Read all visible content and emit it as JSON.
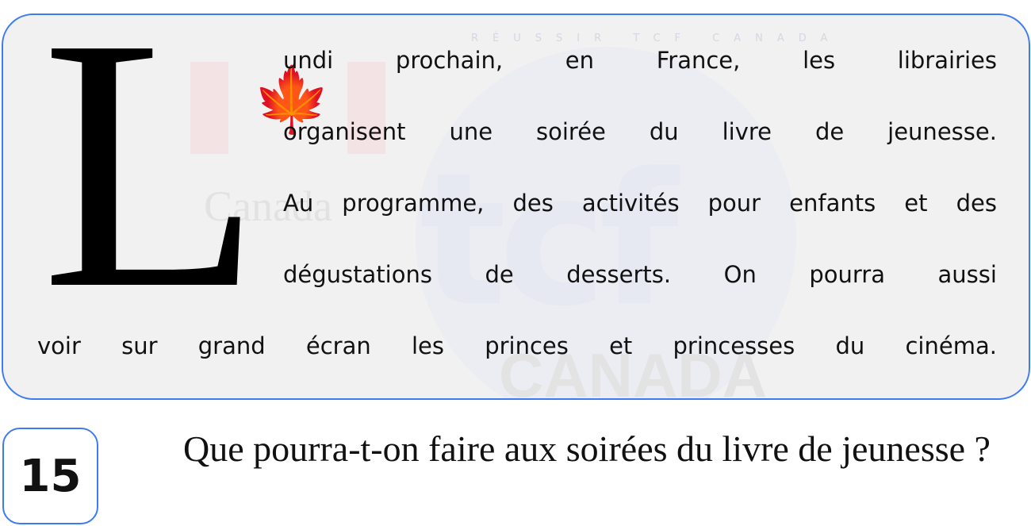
{
  "passage": {
    "drop_cap": "L",
    "lines": [
      "undi prochain, en France, les librairies",
      "organisent une soirée du livre de jeunesse.",
      "Au programme, des activités pour enfants et des",
      "dégustations de desserts. On pourra aussi",
      "voir sur grand écran les princes et princesses du cinéma."
    ]
  },
  "watermark": {
    "canada_wordmark": "Canada",
    "ring_text": "RÉUSSIR TCF CANADA",
    "logo_text": "tcf",
    "logo_subtext": "CANADA"
  },
  "question": {
    "number": "15",
    "text": "Que pourra-t-on faire aux soirées du livre de jeunesse ?"
  },
  "colors": {
    "accent_border": "#3d7cf0",
    "card_background": "#f1f1f1"
  }
}
